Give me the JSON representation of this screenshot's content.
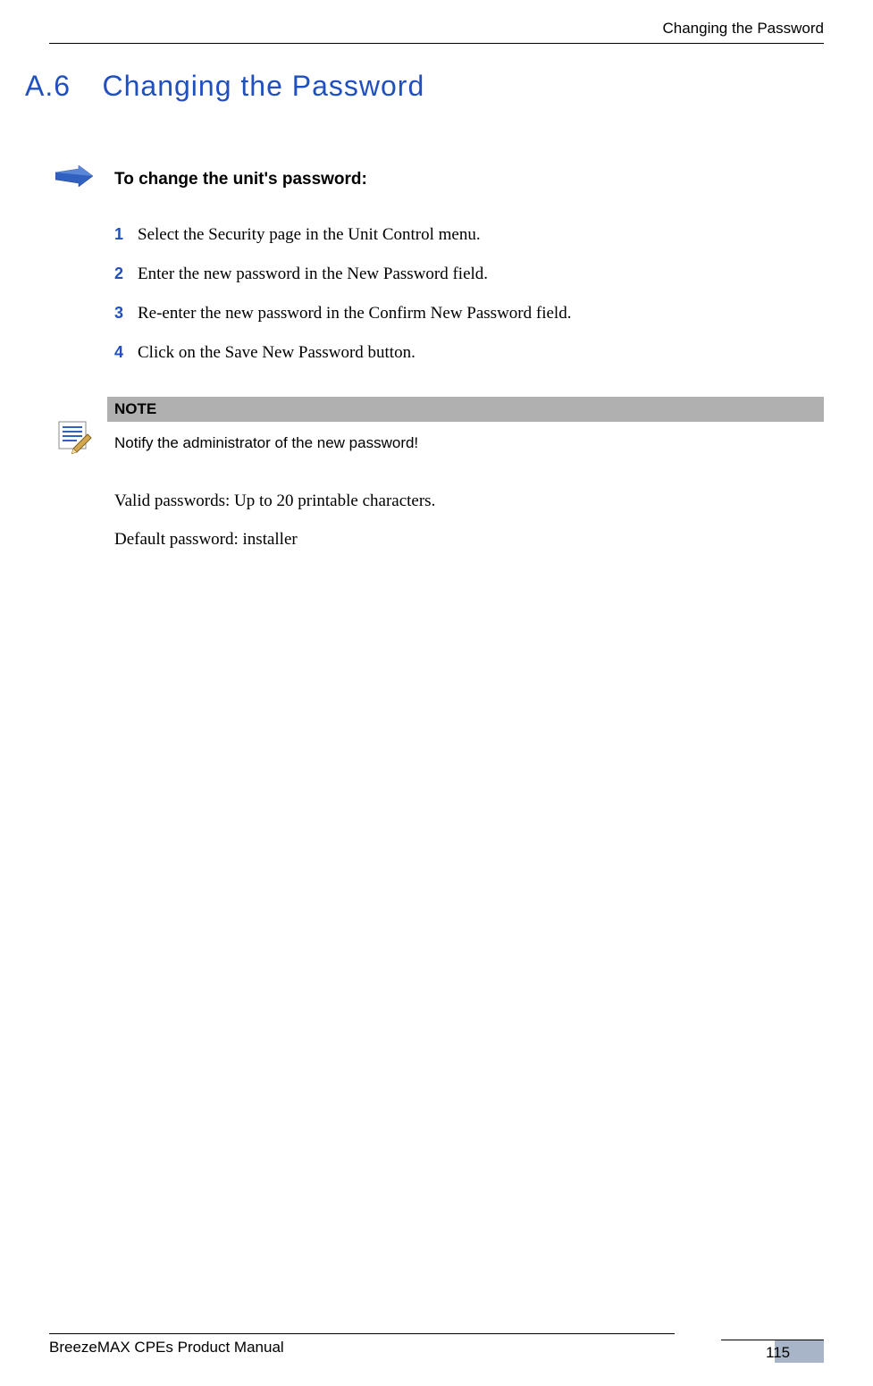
{
  "header": {
    "running_head": "Changing the Password"
  },
  "section": {
    "number": "A.6",
    "title": "Changing the Password"
  },
  "procedure": {
    "title": "To change the unit's password:",
    "steps": [
      {
        "num": "1",
        "text": "Select the Security page in the Unit Control menu."
      },
      {
        "num": "2",
        "text": "Enter the new password in the New Password field."
      },
      {
        "num": "3",
        "text": "Re-enter the new password in the Confirm New Password field."
      },
      {
        "num": "4",
        "text": "Click on the Save New Password button."
      }
    ]
  },
  "note": {
    "label": "NOTE",
    "body": "Notify the administrator of the new password!"
  },
  "body": {
    "valid_passwords": "Valid passwords: Up to 20 printable characters.",
    "default_password": "Default password: installer"
  },
  "footer": {
    "manual": "BreezeMAX CPEs Product Manual",
    "page": "115"
  }
}
